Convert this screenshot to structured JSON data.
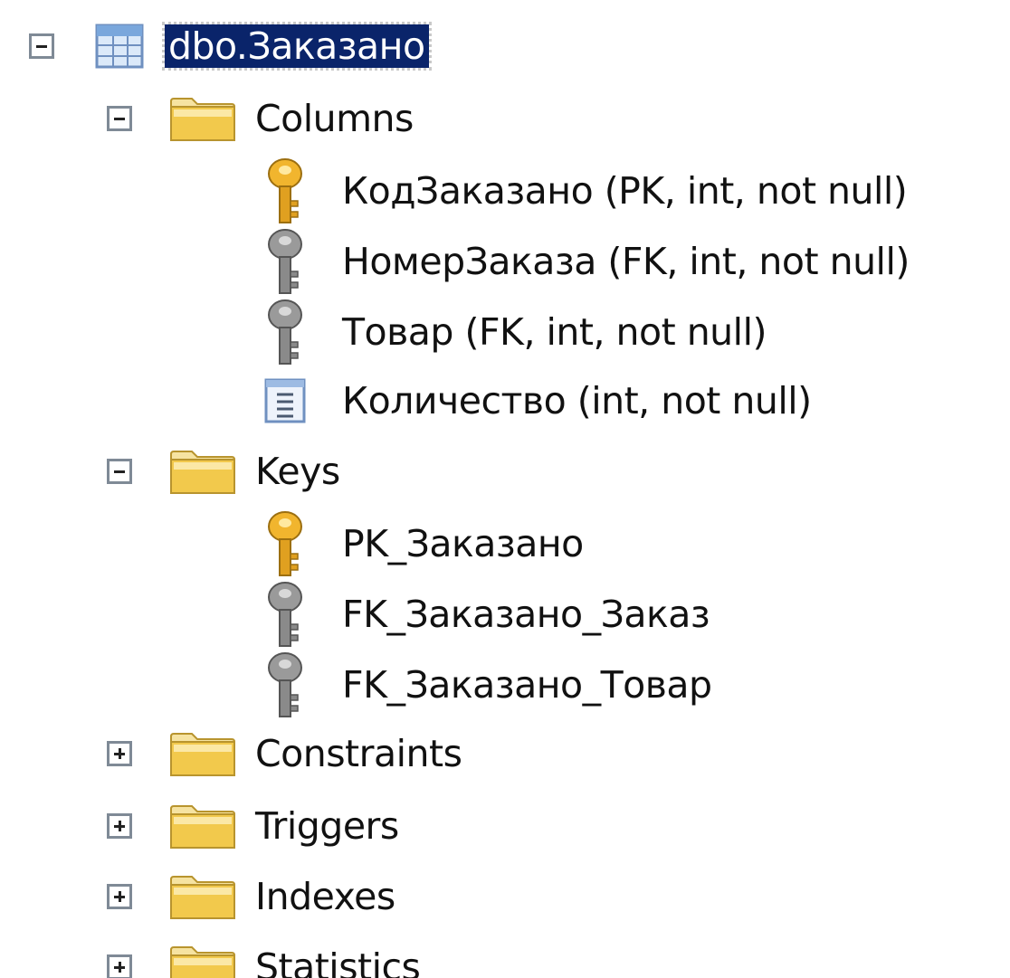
{
  "tree": {
    "table": {
      "label": "dbo.Заказано",
      "expander": "collapse",
      "icon": "table-icon"
    },
    "columns_folder": {
      "label": "Columns",
      "expander": "collapse",
      "icon": "folder-icon",
      "items": [
        {
          "label": "КодЗаказано (PK, int, not null)",
          "icon": "primary-key-icon"
        },
        {
          "label": "НомерЗаказа (FK, int, not null)",
          "icon": "foreign-key-icon"
        },
        {
          "label": "Товар (FK, int, not null)",
          "icon": "foreign-key-icon"
        },
        {
          "label": "Количество (int, not null)",
          "icon": "column-icon"
        }
      ]
    },
    "keys_folder": {
      "label": "Keys",
      "expander": "collapse",
      "icon": "folder-icon",
      "items": [
        {
          "label": "PK_Заказано",
          "icon": "primary-key-icon"
        },
        {
          "label": "FK_Заказано_Заказ",
          "icon": "foreign-key-icon"
        },
        {
          "label": "FK_Заказано_Товар",
          "icon": "foreign-key-icon"
        }
      ]
    },
    "collapsed_folders": [
      {
        "label": "Constraints",
        "expander": "expand",
        "icon": "folder-icon"
      },
      {
        "label": "Triggers",
        "expander": "expand",
        "icon": "folder-icon"
      },
      {
        "label": "Indexes",
        "expander": "expand",
        "icon": "folder-icon"
      },
      {
        "label": "Statistics",
        "expander": "expand",
        "icon": "folder-icon"
      }
    ]
  },
  "colors": {
    "selection": "#0a246a",
    "folder": "#f2c94c",
    "primary_key": "#e0a020",
    "foreign_key": "#8a8a8a"
  }
}
